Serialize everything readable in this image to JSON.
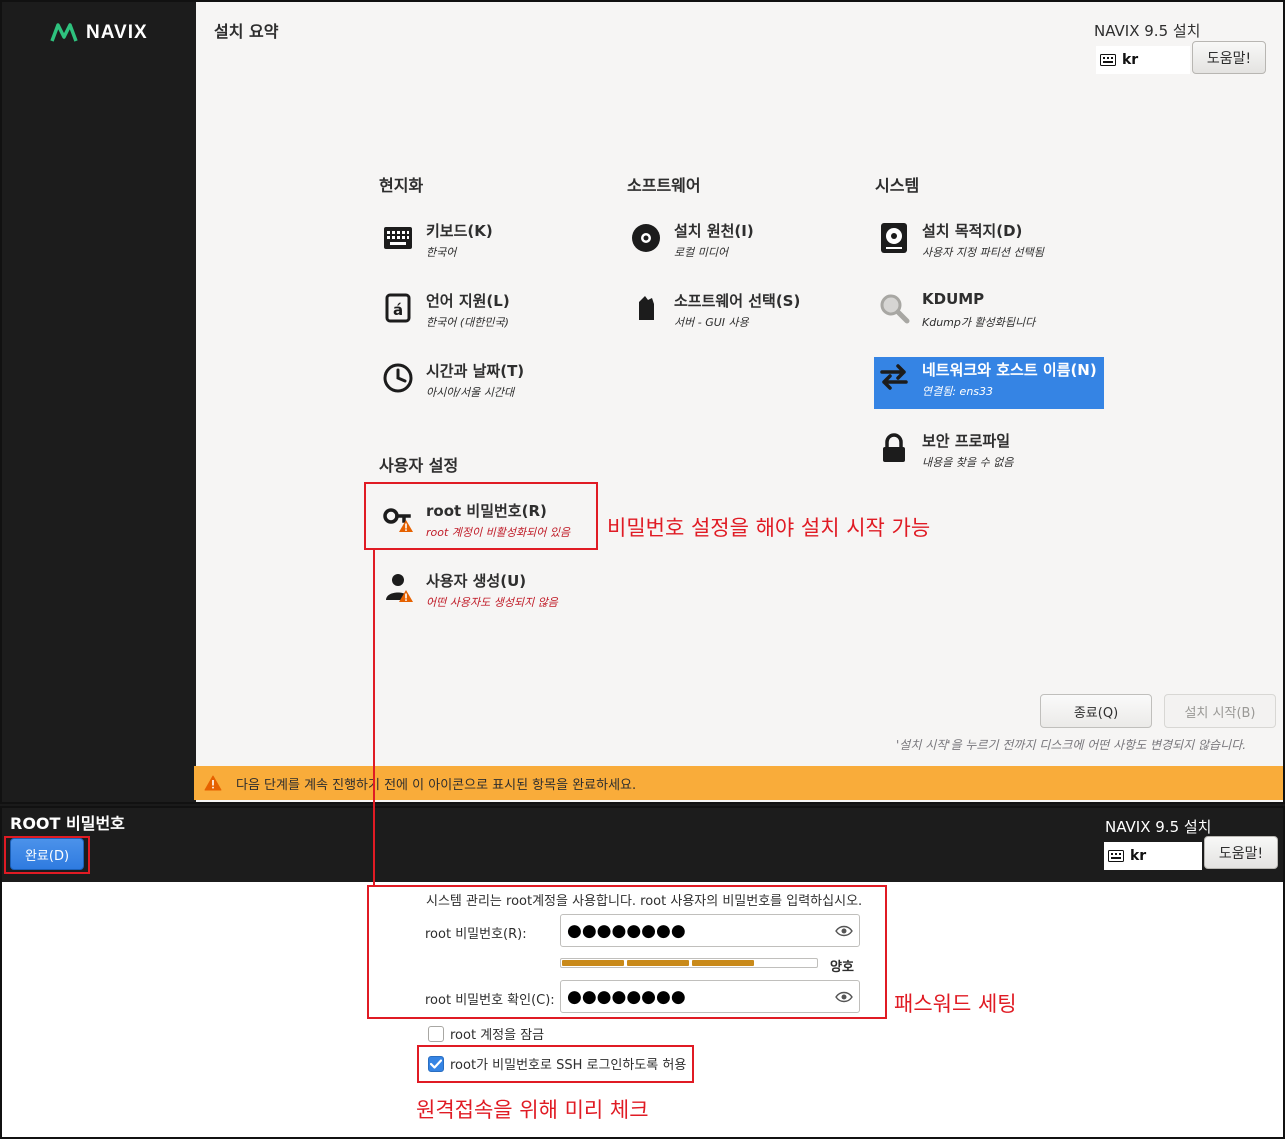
{
  "summary": {
    "logo_text": "NAVIX",
    "title": "설치 요약",
    "product_title": "NAVIX 9.5 설치",
    "keyboard_layout": "kr",
    "help_label": "도움말!",
    "sections": {
      "localization": "현지화",
      "software": "소프트웨어",
      "system": "시스템",
      "user_settings": "사용자 설정"
    },
    "spokes": {
      "keyboard": {
        "name": "키보드(K)",
        "status": "한국어",
        "icon": "keyboard-icon"
      },
      "language": {
        "name": "언어 지원(L)",
        "status": "한국어 (대한민국)",
        "icon": "language-icon"
      },
      "time": {
        "name": "시간과 날짜(T)",
        "status": "아시아/서울 시간대",
        "icon": "clock-icon"
      },
      "source": {
        "name": "설치 원천(I)",
        "status": "로컬 미디어",
        "icon": "disc-icon"
      },
      "software_selection": {
        "name": "소프트웨어 선택(S)",
        "status": "서버 - GUI 사용",
        "icon": "package-icon"
      },
      "destination": {
        "name": "설치 목적지(D)",
        "status": "사용자 지정 파티션 선택됨",
        "icon": "harddisk-icon"
      },
      "kdump": {
        "name": "KDUMP",
        "status": "Kdump가 활성화됩니다",
        "icon": "search-icon"
      },
      "network": {
        "name": "네트워크와 호스트 이름(N)",
        "status": "연결됨: ens33",
        "icon": "network-arrows-icon"
      },
      "security": {
        "name": "보안 프로파일",
        "status": "내용을 찾을 수 없음",
        "icon": "lock-icon"
      },
      "root_password": {
        "name": "root 비밀번호(R)",
        "status": "root 계정이 비활성화되어 있음",
        "icon": "key-warning-icon"
      },
      "user_creation": {
        "name": "사용자 생성(U)",
        "status": "어떤 사용자도 생성되지 않음",
        "icon": "user-warning-icon"
      }
    },
    "quit_label": "종료(Q)",
    "begin_label": "설치 시작(B)",
    "begin_note": "'설치 시작'을 누르기 전까지 디스크에 어떤 사항도 변경되지 않습니다.",
    "warning_text": "다음 단계를 계속 진행하기 전에 이 아이콘으로 표시된 항목을 완료하세요."
  },
  "root_page": {
    "title": "ROOT 비밀번호",
    "done_label": "완료(D)",
    "product_title": "NAVIX 9.5 설치",
    "keyboard_layout": "kr",
    "help_label": "도움말!",
    "description": "시스템 관리는 root계정을 사용합니다. root 사용자의 비밀번호를 입력하십시오.",
    "password_label": "root 비밀번호(R):",
    "password_value": "●●●●●●●●",
    "confirm_label": "root 비밀번호 확인(C):",
    "confirm_value": "●●●●●●●●",
    "strength_label": "양호",
    "strength_fraction": 0.75,
    "lock_account_label": "root 계정을 잠금",
    "lock_account_checked": false,
    "allow_ssh_label": "root가 비밀번호로 SSH 로그인하도록 허용",
    "allow_ssh_checked": true
  },
  "annotations": {
    "root_note": "비밀번호 설정을 해야 설치 시작 가능",
    "password_note": "패스워드 세팅",
    "ssh_note": "원격접속을 위해 미리 체크"
  },
  "colors": {
    "accent_blue": "#3584e4",
    "warning_orange": "#f9ac3a",
    "annotation_red": "#e01b24",
    "sidebar_dark": "#1c1c1c"
  }
}
